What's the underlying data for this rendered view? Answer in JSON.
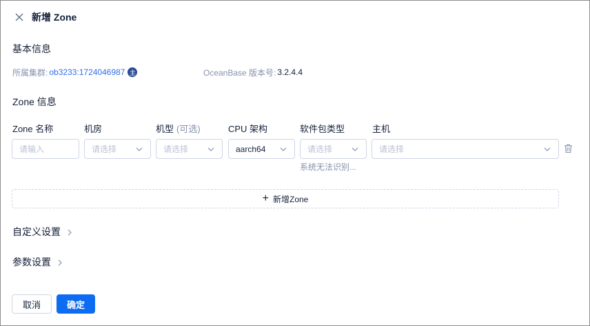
{
  "header": {
    "title": "新增 Zone"
  },
  "basic_info": {
    "title": "基本信息",
    "cluster_label": "所属集群:",
    "cluster_value": "ob3233:1724046987",
    "cluster_tag": "主",
    "version_label": "OceanBase 版本号:",
    "version_value": "3.2.4.4"
  },
  "zone_info": {
    "title": "Zone 信息",
    "columns": {
      "zone_name": "Zone 名称",
      "idc": "机房",
      "machine_type": "机型",
      "machine_type_optional": "(可选)",
      "cpu_arch": "CPU 架构",
      "package_type": "软件包类型",
      "host": "主机"
    },
    "fields": {
      "zone_name_placeholder": "请输入",
      "idc_placeholder": "请选择",
      "machine_type_placeholder": "请选择",
      "cpu_arch_value": "aarch64",
      "package_type_placeholder": "请选择",
      "host_placeholder": "请选择"
    },
    "package_hint": "系统无法识别...",
    "add_zone_label": "新增Zone"
  },
  "sections": {
    "custom_settings": "自定义设置",
    "param_settings": "参数设置"
  },
  "footer": {
    "cancel_label": "取消",
    "ok_label": "确定"
  }
}
